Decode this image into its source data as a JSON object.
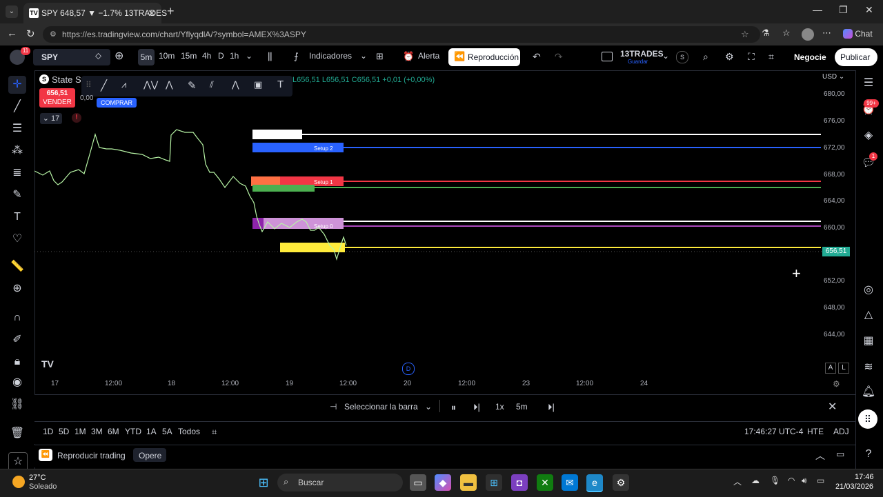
{
  "browser": {
    "tab_title": "SPY 648,57 ▼ −1.7% 13TRADES",
    "url": "https://es.tradingview.com/chart/YflyqdlA/?symbol=AMEX%3ASPY",
    "chat_label": "Chat"
  },
  "tv_header": {
    "symbol": "SPY",
    "timeframes": [
      "5m",
      "10m",
      "15m",
      "4h",
      "D",
      "1h"
    ],
    "indicators_label": "Indicadores",
    "alert_label": "Alerta",
    "replay_label": "Reproducción",
    "layout_name": "13TRADES",
    "layout_save": "Guardar",
    "layout_badge": "S",
    "trade_label": "Negocie",
    "publish_label": "Publicar"
  },
  "legend": {
    "title": "State St",
    "ohlc": "L656,51  L656,51  C656,51  +0,01 (+0,00%)",
    "sell_price": "656,51",
    "sell_label": "VENDER",
    "spread": "0,00",
    "buy_label": "COMPRAR",
    "indicator_count": "17",
    "currency": "USD"
  },
  "price_axis": [
    "680,00",
    "676,00",
    "672,00",
    "668,00",
    "664,00",
    "660,00",
    "656,51",
    "652,00",
    "648,00",
    "644,00"
  ],
  "current_price": "656,51",
  "time_axis": [
    "17",
    "12:00",
    "18",
    "12:00",
    "19",
    "12:00",
    "20",
    "12:00",
    "23",
    "12:00",
    "24"
  ],
  "chart_badges": {
    "d_marker": "D",
    "auto_a": "A",
    "log_l": "L"
  },
  "zones": [
    {
      "label": "Setup 2",
      "price": 672.0,
      "color": "#2962ff"
    },
    {
      "label": "Setup 1",
      "price": 667.0,
      "color": "#f23645"
    },
    {
      "label": "Setup 0",
      "price": 660.5,
      "color": "#d1c4e9"
    }
  ],
  "replay_bar": {
    "select_bar": "Seleccionar la barra",
    "speed": "1x",
    "interval": "5m"
  },
  "range_bar": {
    "ranges": [
      "1D",
      "5D",
      "1M",
      "3M",
      "6M",
      "YTD",
      "1A",
      "5A",
      "Todos"
    ],
    "clock": "17:46:27 UTC-4",
    "session": "HTE",
    "adj": "ADJ"
  },
  "panel_bar": {
    "title": "Reproducir trading",
    "tab": "Opere"
  },
  "taskbar": {
    "temperature": "27°C",
    "weather": "Soleado",
    "search_placeholder": "Buscar",
    "time": "17:46",
    "date": "21/03/2026"
  },
  "badges": {
    "profile": "11",
    "notif": "99+",
    "chat": "1"
  },
  "colors": {
    "up": "#22ab94",
    "down": "#f23645",
    "accent": "#2962ff",
    "price_line": "#ffeb3b"
  }
}
